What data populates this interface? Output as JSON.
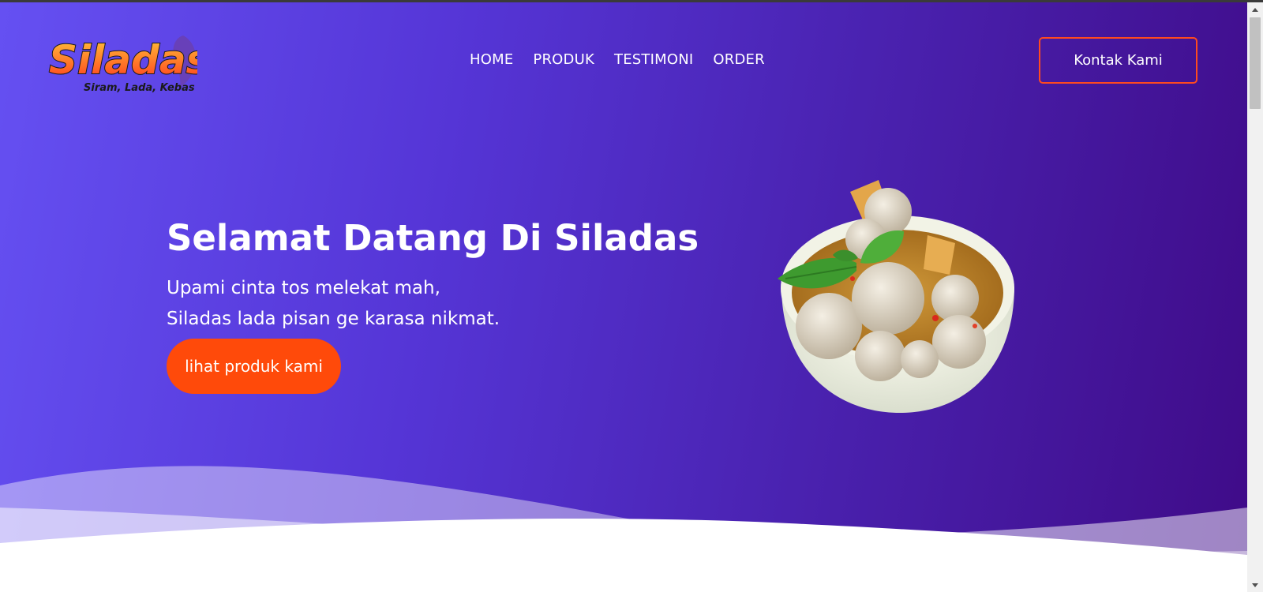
{
  "logo": {
    "brand": "Siladas",
    "tagline": "Siram, Lada, Kebas"
  },
  "nav": {
    "items": [
      {
        "label": "HOME"
      },
      {
        "label": "PRODUK"
      },
      {
        "label": "TESTIMONI"
      },
      {
        "label": "ORDER"
      }
    ],
    "contact_label": "Kontak Kami"
  },
  "hero": {
    "title": "Selamat Datang Di Siladas",
    "subtitle_line1": "Upami cinta tos melekat mah,",
    "subtitle_line2": "Siladas lada pisan ge karasa nikmat.",
    "cta_label": "lihat produk kami",
    "image_icon": "meatball-bowl-image"
  },
  "colors": {
    "gradient_start": "#6550f2",
    "gradient_end": "#3f0b88",
    "accent": "#ff4a0a",
    "text": "#ffffff"
  },
  "scrollbar": {
    "up_icon": "triangle-up-icon",
    "down_icon": "triangle-down-icon"
  }
}
